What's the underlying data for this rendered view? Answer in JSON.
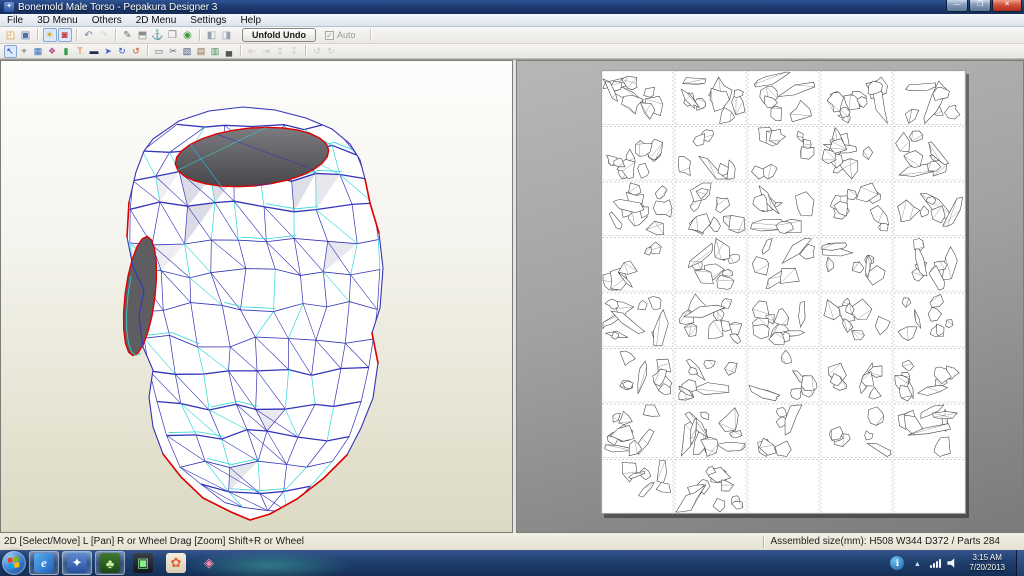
{
  "window": {
    "title": "Bonemold Male Torso - Pepakura Designer 3",
    "app_icon_glyph": "✦"
  },
  "menu_bar": {
    "items": [
      "File",
      "3D Menu",
      "Others",
      "2D Menu",
      "Settings",
      "Help"
    ]
  },
  "toolbar_top": {
    "unfold_undo_label": "Unfold Undo",
    "auto_label": "Auto",
    "auto_checked_glyph": "✓",
    "icons": [
      {
        "base": "open-file",
        "glyph": "◰",
        "color": "#d79b2a"
      },
      {
        "base": "save-file",
        "glyph": "▣",
        "color": "#4a6fa5"
      },
      {
        "sep": true
      },
      {
        "base": "light-toggle",
        "glyph": "☀",
        "color": "#dfa300",
        "pressed": true
      },
      {
        "base": "texture-toggle",
        "glyph": "◙",
        "color": "#c23a3a",
        "pressed": true
      },
      {
        "sep": true
      },
      {
        "base": "undo",
        "glyph": "↶",
        "color": "#6f8696"
      },
      {
        "base": "redo",
        "glyph": "↷",
        "color": "#9db0bd",
        "disabled": true
      },
      {
        "sep": true
      },
      {
        "base": "pen-tool",
        "glyph": "✎",
        "color": "#6e6e6e"
      },
      {
        "base": "measure-box",
        "glyph": "⬒",
        "color": "#8a8a8a"
      },
      {
        "base": "anchor-tool",
        "glyph": "⚓",
        "color": "#5a6f85"
      },
      {
        "base": "edit-box",
        "glyph": "❐",
        "color": "#86869a"
      },
      {
        "base": "magnet-tool",
        "glyph": "◉",
        "color": "#3f9b3f"
      },
      {
        "sep": true
      },
      {
        "base": "window-3d-view",
        "glyph": "◧",
        "color": "#97a1b2"
      },
      {
        "base": "window-2d-view",
        "glyph": "◨",
        "color": "#97a1b2"
      }
    ]
  },
  "toolbar_second": {
    "icons": [
      {
        "base": "select-move",
        "glyph": "↖",
        "color": "#1c3f94",
        "pressed": true
      },
      {
        "base": "lasso-select",
        "glyph": "⌖",
        "color": "#6a6a6a"
      },
      {
        "base": "image-insert",
        "glyph": "▦",
        "color": "#3a6fbf"
      },
      {
        "base": "paint-brush",
        "glyph": "❖",
        "color": "#b3478f"
      },
      {
        "base": "material-tool",
        "glyph": "▮",
        "color": "#2f9d4f"
      },
      {
        "base": "text-insert",
        "glyph": "T",
        "color": "#e07820"
      },
      {
        "base": "monitor-view",
        "glyph": "▬",
        "color": "#1d2b56"
      },
      {
        "base": "flip-part",
        "glyph": "➤",
        "color": "#3a66c0"
      },
      {
        "base": "rotate-part-cw",
        "glyph": "↻",
        "color": "#2a57c4"
      },
      {
        "base": "rotate-part-ccw",
        "glyph": "↺",
        "color": "#c0622a"
      },
      {
        "sep": true
      },
      {
        "base": "select-area",
        "glyph": "▭",
        "color": "#5a5a6a"
      },
      {
        "base": "divide-edge",
        "glyph": "✂",
        "color": "#55616e"
      },
      {
        "base": "join-edge",
        "glyph": "▧",
        "color": "#44507a"
      },
      {
        "base": "stack-parts",
        "glyph": "▤",
        "color": "#8a6a3a"
      },
      {
        "base": "export-image",
        "glyph": "▥",
        "color": "#3a8a5a"
      },
      {
        "base": "print-sheet",
        "glyph": "▄",
        "color": "#555555"
      },
      {
        "sep": true
      },
      {
        "base": "align-left",
        "glyph": "⇤",
        "color": "#7788aa",
        "disabled": true
      },
      {
        "base": "align-right",
        "glyph": "⇥",
        "color": "#7788aa",
        "disabled": true
      },
      {
        "base": "align-top",
        "glyph": "↥",
        "color": "#7788aa",
        "disabled": true
      },
      {
        "base": "align-bottom",
        "glyph": "↧",
        "color": "#7788aa",
        "disabled": true
      },
      {
        "sep": true
      },
      {
        "base": "rotate-left",
        "glyph": "↺",
        "color": "#7788aa",
        "disabled": true
      },
      {
        "base": "rotate-right",
        "glyph": "↻",
        "color": "#7788aa",
        "disabled": true
      }
    ]
  },
  "view_3d": {
    "colors": {
      "edge_blue": "#3434b8",
      "fold_cyan": "#2fd6d6",
      "cut_red": "#e00000",
      "face_white": "#ffffff",
      "face_shade": "#cfcfdd",
      "opening_dark": "#5e5e62"
    }
  },
  "view_2d": {
    "sheet": {
      "columns": 5,
      "rows": 8,
      "pages_with_parts": 37
    },
    "colors": {
      "background_top": "#b7b7b7",
      "background_bottom": "#7a7a7a",
      "page_fill": "#ffffff",
      "page_border_dashed": "#c4c4c4",
      "part_outline": "#3f3f3f"
    }
  },
  "status_bar": {
    "hint": "2D [Select/Move] L [Pan] R or Wheel Drag [Zoom] Shift+R or Wheel",
    "assembled_info": "Assembled size(mm): H508 W344 D372 / Parts 284"
  },
  "taskbar": {
    "apps": [
      {
        "base": "internet-explorer",
        "glyph": "e",
        "fg": "#eaf4ff",
        "bg": "linear-gradient(135deg,#59b0f2,#1d5fb8)",
        "framed": true,
        "italic": true
      },
      {
        "base": "pepakura-designer",
        "glyph": "✦",
        "fg": "#ffffff",
        "bg": "linear-gradient(#5f8ad2,#27509c)",
        "framed": true,
        "active": true
      },
      {
        "base": "fern-viewer",
        "glyph": "♣",
        "fg": "#c6f09a",
        "bg": "linear-gradient(#3f7a2f,#1c4516)",
        "framed": true
      },
      {
        "base": "media-player",
        "glyph": "▣",
        "fg": "#8af08a",
        "bg": "linear-gradient(#3a3f4a,#14161c)",
        "framed": false
      },
      {
        "base": "paint-app",
        "glyph": "✿",
        "fg": "#e0622f",
        "bg": "linear-gradient(#f7efdd,#d9cdb4)",
        "framed": false
      },
      {
        "base": "wireframe-viewer",
        "glyph": "◈",
        "fg": "#ff8ab2",
        "bg": "transparent",
        "framed": false
      }
    ],
    "tray": {
      "info_glyph": "ℹ",
      "hidden_icons_glyph": "▴",
      "time": "3:15 AM",
      "date": "7/20/2013"
    },
    "orb_colors": [
      "#e8452c",
      "#7eba00",
      "#00a3ee",
      "#ffb900"
    ]
  }
}
